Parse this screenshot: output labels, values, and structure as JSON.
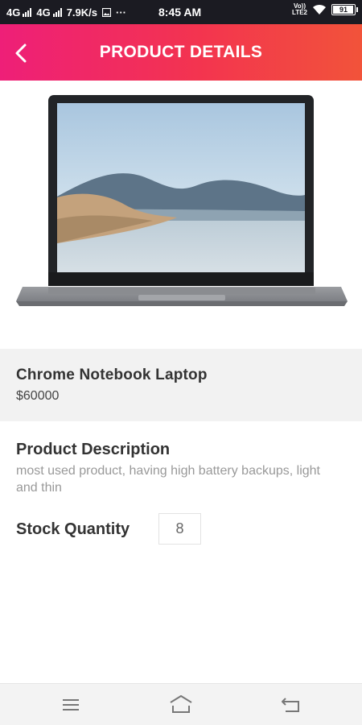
{
  "status_bar": {
    "network1": "4G",
    "network2": "4G",
    "speed": "7.9K/s",
    "more": "···",
    "time": "8:45 AM",
    "volte_top": "Vo))",
    "volte_bottom": "LTE2",
    "battery": "91"
  },
  "header": {
    "title": "PRODUCT DETAILS",
    "back_icon": "chevron-left-icon"
  },
  "product": {
    "name": "Chrome Notebook Laptop",
    "price": "$60000",
    "image": "laptop-image"
  },
  "description": {
    "title": "Product Description",
    "text": "most used product, having high battery backups, light and thin"
  },
  "stock": {
    "label": "Stock Quantity",
    "value": "8"
  },
  "nav_bar": {
    "icons": [
      "menu-icon",
      "home-icon",
      "back-icon"
    ]
  },
  "colors": {
    "header_gradient_start": "#ee1f78",
    "header_gradient_end": "#f2533a",
    "info_band": "#f2f2f2"
  }
}
